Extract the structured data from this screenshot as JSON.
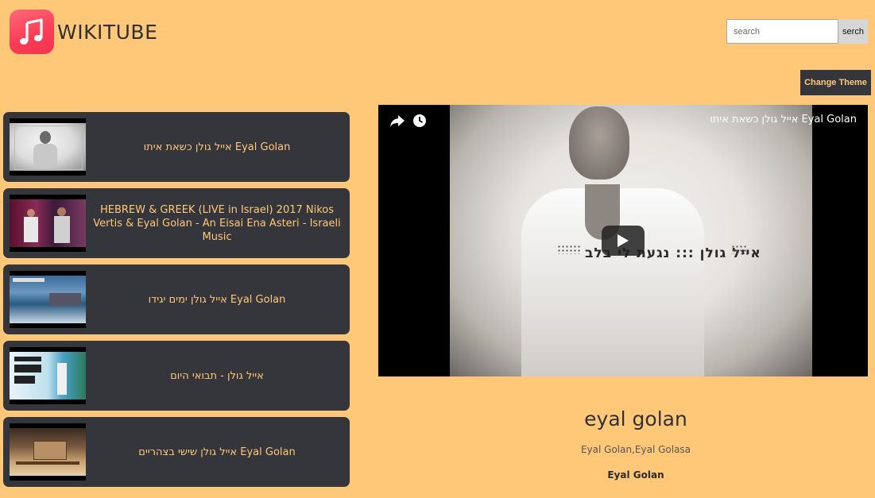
{
  "header": {
    "brand": "WIKITUBE",
    "search": {
      "placeholder": "search",
      "button_label": "serch"
    },
    "theme_button_label": "Change Theme"
  },
  "colors": {
    "background": "#ffc878",
    "card": "#35363b",
    "accent_text": "#ffc878",
    "logo": "#fb3b55"
  },
  "icons": [
    "music-note-icon",
    "share-icon",
    "clock-icon",
    "play-icon"
  ],
  "video_list": [
    {
      "title": "אייל גולן כשאת איתו Eyal Golan"
    },
    {
      "title": "HEBREW & GREEK (LIVE in Israel) 2017 Nikos Vertis & Eyal Golan - An Eisai Ena Asteri - Israeli Music"
    },
    {
      "title": "אייל גולן ימים יגידו Eyal Golan"
    },
    {
      "title": "אייל גולן - תבואי היום"
    },
    {
      "title": "אייל גולן שישי בצהריים Eyal Golan"
    }
  ],
  "player": {
    "title": "אייל גולן כשאת איתו Eyal Golan",
    "overlay_text": "אייל גולן ::: נגעת לי בלב"
  },
  "current_video": {
    "title": "eyal golan",
    "tags": "Eyal Golan,Eyal Golasa",
    "channel": "Eyal Golan"
  }
}
